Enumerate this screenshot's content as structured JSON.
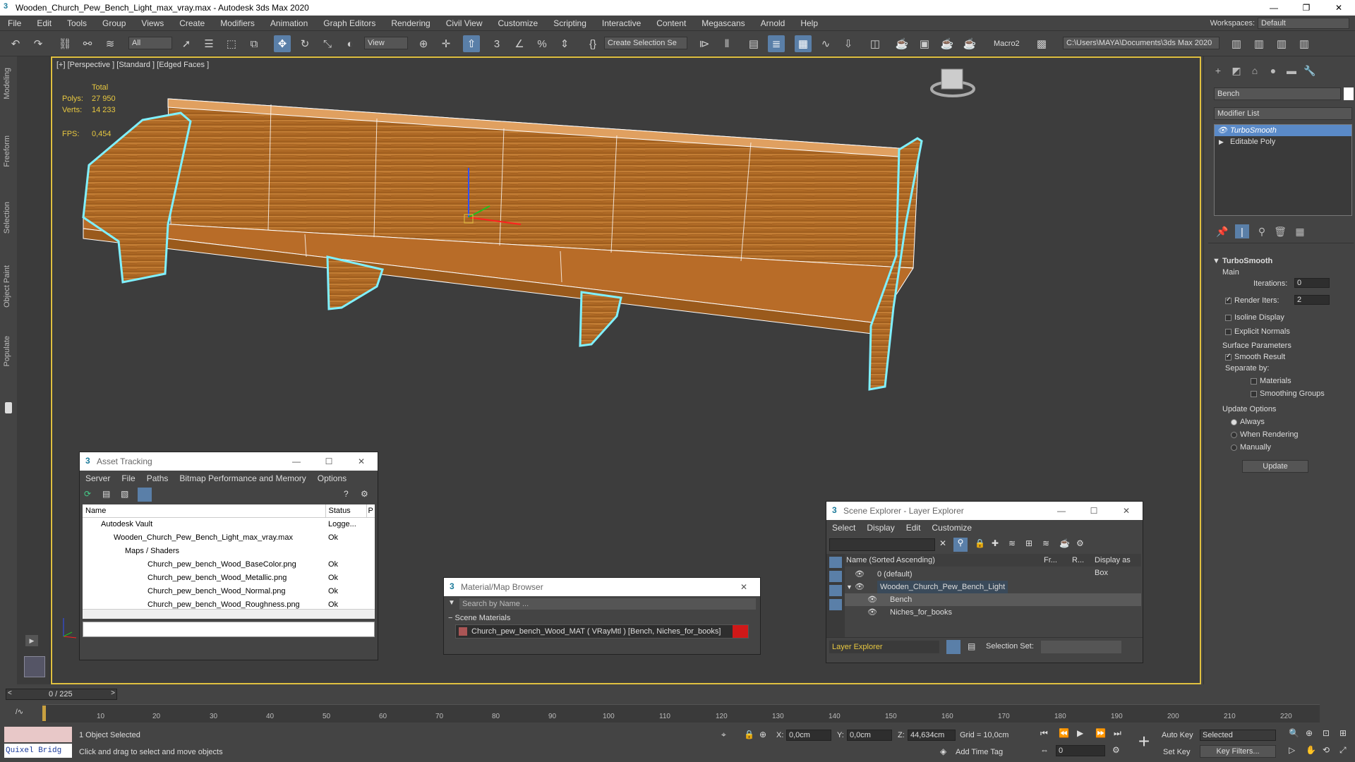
{
  "window": {
    "title": "Wooden_Church_Pew_Bench_Light_max_vray.max - Autodesk 3ds Max 2020",
    "controls": [
      "—",
      "❐",
      "✕"
    ]
  },
  "menu": [
    "File",
    "Edit",
    "Tools",
    "Group",
    "Views",
    "Create",
    "Modifiers",
    "Animation",
    "Graph Editors",
    "Rendering",
    "Civil View",
    "Customize",
    "Scripting",
    "Interactive",
    "Content",
    "Megascans",
    "Arnold",
    "Help"
  ],
  "workspace": {
    "label": "Workspaces:",
    "value": "Default"
  },
  "toolbar": {
    "selection_filter": "All",
    "ref_coord": "View",
    "named_selection": "Create Selection Se",
    "macro": "Macro2",
    "path": "C:\\Users\\MAYA\\Documents\\3ds Max 2020"
  },
  "left_tabs": [
    "Modeling",
    "Freeform",
    "Selection",
    "Object Paint",
    "Populate"
  ],
  "viewport": {
    "label": "[+] [Perspective ] [Standard ] [Edged Faces ]",
    "stats": {
      "total_label": "Total",
      "polys_label": "Polys:",
      "polys": "27 950",
      "verts_label": "Verts:",
      "verts": "14 233",
      "fps_label": "FPS:",
      "fps": "0,454"
    },
    "colors": {
      "wood": "#b8742a",
      "outline": "#7ff0ff",
      "wire": "#ffffff"
    }
  },
  "command_panel": {
    "object_name": "Bench",
    "modifier_list": "Modifier List",
    "stack": [
      "TurboSmooth",
      "Editable Poly"
    ],
    "rollout_title": "TurboSmooth",
    "main_label": "Main",
    "iterations_label": "Iterations:",
    "iterations": "0",
    "render_iters_label": "Render Iters:",
    "render_iters": "2",
    "isoline": "Isoline Display",
    "explicit_normals": "Explicit Normals",
    "surface_params": "Surface Parameters",
    "smooth_result": "Smooth Result",
    "separate_by": "Separate by:",
    "materials": "Materials",
    "smoothing_groups": "Smoothing Groups",
    "update_options": "Update Options",
    "always": "Always",
    "when_rendering": "When Rendering",
    "manually": "Manually",
    "update_btn": "Update"
  },
  "asset_tracking": {
    "title": "Asset Tracking",
    "menu": [
      "Server",
      "File",
      "Paths",
      "Bitmap Performance and Memory",
      "Options"
    ],
    "columns": [
      "Name",
      "Status",
      "P"
    ],
    "rows": [
      {
        "name": "Autodesk Vault",
        "status": "Logge...",
        "indent": 1
      },
      {
        "name": "Wooden_Church_Pew_Bench_Light_max_vray.max",
        "status": "Ok",
        "indent": 2
      },
      {
        "name": "Maps / Shaders",
        "status": "",
        "indent": 3
      },
      {
        "name": "Church_pew_bench_Wood_BaseColor.png",
        "status": "Ok",
        "indent": 4
      },
      {
        "name": "Church_pew_bench_Wood_Metallic.png",
        "status": "Ok",
        "indent": 4
      },
      {
        "name": "Church_pew_bench_Wood_Normal.png",
        "status": "Ok",
        "indent": 4
      },
      {
        "name": "Church_pew_bench_Wood_Roughness.png",
        "status": "Ok",
        "indent": 4
      }
    ]
  },
  "material_browser": {
    "title": "Material/Map Browser",
    "search_placeholder": "Search by Name ...",
    "section": "Scene Materials",
    "item": "Church_pew_bench_Wood_MAT  ( VRayMtl ) [Bench, Niches_for_books]"
  },
  "scene_explorer": {
    "title": "Scene Explorer - Layer Explorer",
    "menu": [
      "Select",
      "Display",
      "Edit",
      "Customize"
    ],
    "columns": [
      "Name (Sorted Ascending)",
      "Fr...",
      "R...",
      "Display as Box"
    ],
    "rows": [
      {
        "name": "0 (default)",
        "indent": 0
      },
      {
        "name": "Wooden_Church_Pew_Bench_Light",
        "indent": 0
      },
      {
        "name": "Bench",
        "indent": 1
      },
      {
        "name": "Niches_for_books",
        "indent": 1
      }
    ],
    "footer_layer": "Layer Explorer",
    "selection_set_label": "Selection Set:"
  },
  "timeline": {
    "frame": "0 / 225",
    "ticks": [
      "10",
      "20",
      "30",
      "40",
      "50",
      "60",
      "70",
      "80",
      "90",
      "100",
      "110",
      "120",
      "130",
      "140",
      "150",
      "160",
      "170",
      "180",
      "190",
      "200",
      "210",
      "220"
    ]
  },
  "status": {
    "quixel": "Quixel Bridg",
    "selected": "1 Object Selected",
    "prompt": "Click and drag to select and move objects",
    "x_label": "X:",
    "x": "0,0cm",
    "y_label": "Y:",
    "y": "0,0cm",
    "z_label": "Z:",
    "z": "44,634cm",
    "grid": "Grid = 10,0cm",
    "add_time_tag": "Add Time Tag",
    "auto_key": "Auto Key",
    "set_key": "Set Key",
    "key_mode": "Selected",
    "key_filters": "Key Filters...",
    "frame_field": "0"
  }
}
